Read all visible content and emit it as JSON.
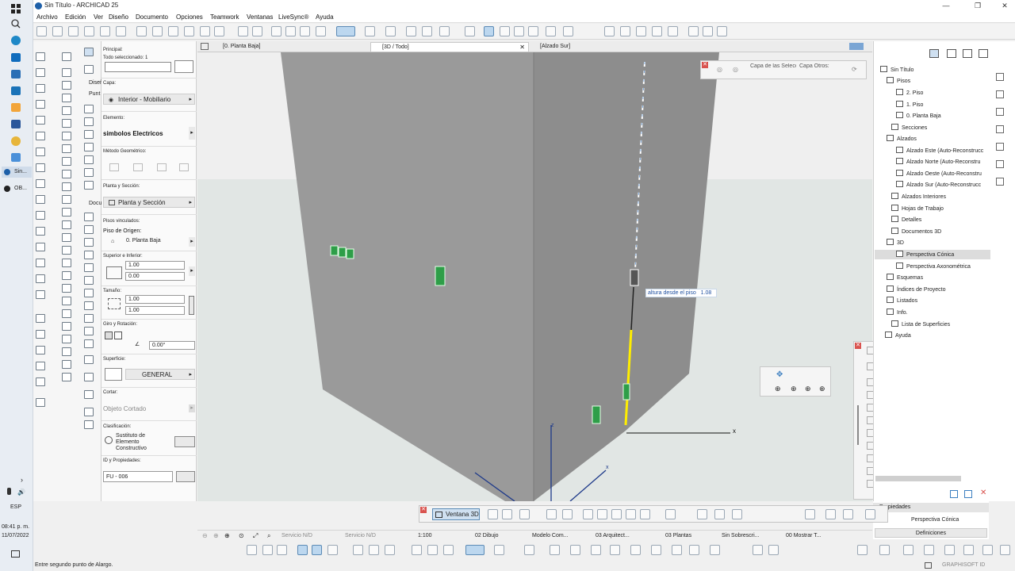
{
  "window": {
    "title": "Sin Título - ARCHICAD 25",
    "minimize_label": "—",
    "maximize_label": "❐",
    "close_label": "✕"
  },
  "taskbar": {
    "items": [
      {
        "label": "Sin..."
      },
      {
        "label": "OB..."
      }
    ],
    "language": "ESP",
    "time": "08:41 p. m.",
    "date": "11/07/2022"
  },
  "menu": [
    "Archivo",
    "Edición",
    "Ver",
    "Diseño",
    "Documento",
    "Opciones",
    "Teamwork",
    "Ventanas",
    "LiveSync®",
    "Ayuda"
  ],
  "toolbox": {
    "categories": [
      "Diseñ",
      "Punt",
      "Docu"
    ]
  },
  "info_box": {
    "principal_label": "Principal:",
    "selection_label": "Todo seleccionado: 1",
    "capa_label": "Capa:",
    "capa_value": "Interior - Mobiliario",
    "elemento_label": "Elemento:",
    "elemento_value": "simbolos Electricos",
    "metodo_label": "Método Geométrico:",
    "planta_label": "Planta y Sección:",
    "planta_value": "Planta y Sección",
    "pisos_label": "Pisos vinculados:",
    "piso_origen_label": "Piso de Origen:",
    "piso_origen_value": "0. Planta Baja",
    "sup_inf_label": "Superior e Inferior:",
    "sup_value": "1.00",
    "inf_value": "0.00",
    "tamano_label": "Tamaño:",
    "width_value": "1.00",
    "height_value": "1.00",
    "giro_label": "Giro y Rotación:",
    "angle_value": "0.00°",
    "superficie_label": "Superficie:",
    "superficie_value": "GENERAL",
    "cortar_label": "Cortar:",
    "cortar_value": "Objeto Cortado",
    "clasificacion_label": "Clasificación:",
    "clasificacion_value": "Sustituto de Elemento Constructivo",
    "id_label": "ID y Propiedades:",
    "id_value": "FU - 006"
  },
  "tabs": [
    {
      "label": "[0. Planta Baja]",
      "active": false
    },
    {
      "label": "[3D / Todo]",
      "active": true
    },
    {
      "label": "[Alzado Sur]",
      "active": false
    }
  ],
  "viewport": {
    "tooltip_label": "altura desde el piso",
    "tooltip_value": "1.08",
    "axis_x": "x",
    "axis_z": "z",
    "axis_x2": "x"
  },
  "layers_palette": {
    "sel_label": "Capa de las Selecc",
    "other_label": "Capa Otros:"
  },
  "navigator": {
    "items": [
      {
        "label": "Sin Título",
        "indent": 0
      },
      {
        "label": "Pisos",
        "indent": 1
      },
      {
        "label": "2. Piso",
        "indent": 2
      },
      {
        "label": "1. Piso",
        "indent": 2
      },
      {
        "label": "0. Planta Baja",
        "indent": 2
      },
      {
        "label": "Secciones",
        "indent": 1
      },
      {
        "label": "Alzados",
        "indent": 1
      },
      {
        "label": "Alzado Este (Auto-Reconstrucc",
        "indent": 2
      },
      {
        "label": "Alzado Norte (Auto-Reconstru",
        "indent": 2
      },
      {
        "label": "Alzado Oeste (Auto-Reconstru",
        "indent": 2
      },
      {
        "label": "Alzado Sur (Auto-Reconstrucc",
        "indent": 2
      },
      {
        "label": "Alzados Interiores",
        "indent": 1
      },
      {
        "label": "Hojas de Trabajo",
        "indent": 1
      },
      {
        "label": "Detalles",
        "indent": 1
      },
      {
        "label": "Documentos 3D",
        "indent": 1
      },
      {
        "label": "3D",
        "indent": 1
      },
      {
        "label": "Perspectiva Cónica",
        "indent": 2,
        "selected": true
      },
      {
        "label": "Perspectiva Axonométrica",
        "indent": 2
      },
      {
        "label": "Esquemas",
        "indent": 1
      },
      {
        "label": "Índices de Proyecto",
        "indent": 1
      },
      {
        "label": "Listados",
        "indent": 1
      },
      {
        "label": "Info.",
        "indent": 1
      },
      {
        "label": "Lista de Superficies",
        "indent": 1
      },
      {
        "label": "Ayuda",
        "indent": 0
      }
    ],
    "properties_label": "Propiedades",
    "properties_value": "Perspectiva Cónica",
    "definitions_button": "Definiciones"
  },
  "floating_3d": {
    "window_label": "Ventana 3D"
  },
  "bottom_bar": {
    "servicio1": "Servicio N/D",
    "servicio2": "Servicio N/D",
    "scale": "1:100",
    "layer_combo": "02 Dibujo",
    "model_view": "Modelo Com...",
    "pen_set": "03 Arquitect...",
    "renovation": "03 Plantas",
    "override": "Sin Sobrescri...",
    "display": "00 Mostrar T..."
  },
  "status": {
    "message": "Entre segundo punto de Alargo.",
    "brand": "GRAPHISOFT ID"
  },
  "colors": {
    "accent": "#3c7fc0",
    "wall": "#9a9a9a",
    "wall_dark": "#8c8c8c",
    "ground": "#e1e6e4",
    "sky": "#efefef",
    "highlight": "#ffee00",
    "symbol_green": "#2e9e48"
  }
}
